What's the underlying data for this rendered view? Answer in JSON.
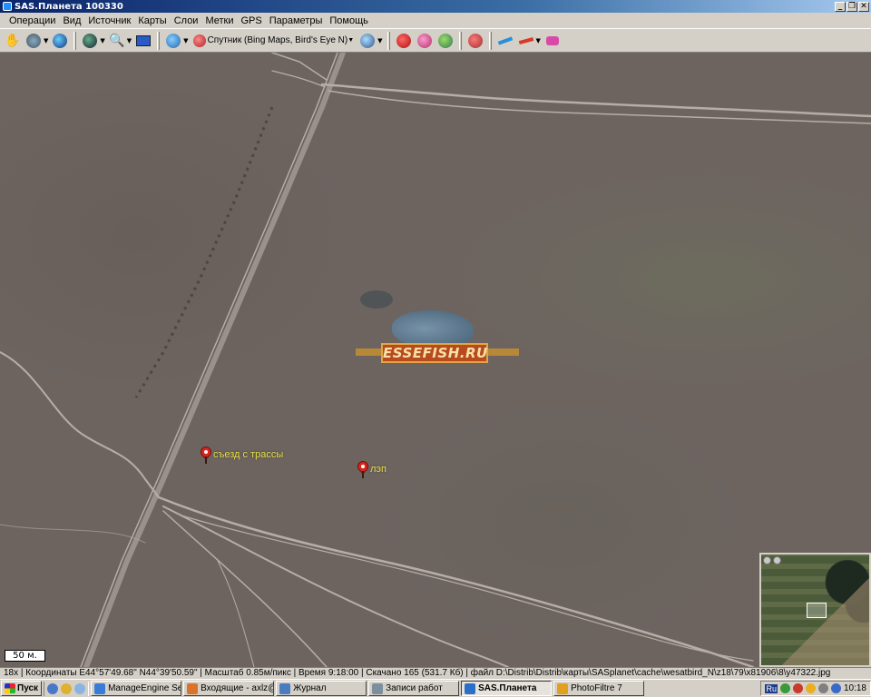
{
  "window": {
    "title": "SAS.Планета 100330",
    "controls": [
      "_",
      "❐",
      "✕"
    ]
  },
  "menu": [
    "Операции",
    "Вид",
    "Источник",
    "Карты",
    "Слои",
    "Метки",
    "GPS",
    "Параметры",
    "Помощь"
  ],
  "toolbar": {
    "map_source_label": "Спутник (Bing Maps, Bird's Eye N)"
  },
  "map": {
    "placemarks": [
      {
        "label": "съезд с трассы"
      },
      {
        "label": "лэп"
      }
    ],
    "watermark_text": "ESSEFISH.RU",
    "scale_label": "50 м."
  },
  "status_bar": {
    "text": "18x | Координаты E44°57'49.68\" N44°39'50.59\" | Масштаб 0.85м/пикс | Время 9:18:00 | Скачано 165 (531.7 Кб) | файл D:\\Distrib\\Distrib\\карты\\SASplanet\\cache\\wesatbird_N\\z18\\79\\x81906\\8\\y47322.jpg"
  },
  "taskbar": {
    "start_label": "Пуск",
    "tasks": [
      {
        "label": "ManageEngine Serv...",
        "color": "#3b7bd8",
        "active": false
      },
      {
        "label": "Входящие - axlz@...",
        "color": "#d9742a",
        "active": false
      },
      {
        "label": "Журнал",
        "color": "#4a7cc2",
        "active": false
      },
      {
        "label": "Записи работ",
        "color": "#7c8f9e",
        "active": false
      },
      {
        "label": "SAS.Планета",
        "color": "#2a6fc9",
        "active": true
      },
      {
        "label": "PhotoFiltre 7",
        "color": "#e0a020",
        "active": false
      }
    ],
    "tray": {
      "lang": "Ru",
      "clock": "10:18"
    }
  },
  "colors": {
    "map_ground": "#6d6460",
    "road": "#b6aea6",
    "placemark_label": "#e7e04a",
    "pin": "#d9261c"
  }
}
